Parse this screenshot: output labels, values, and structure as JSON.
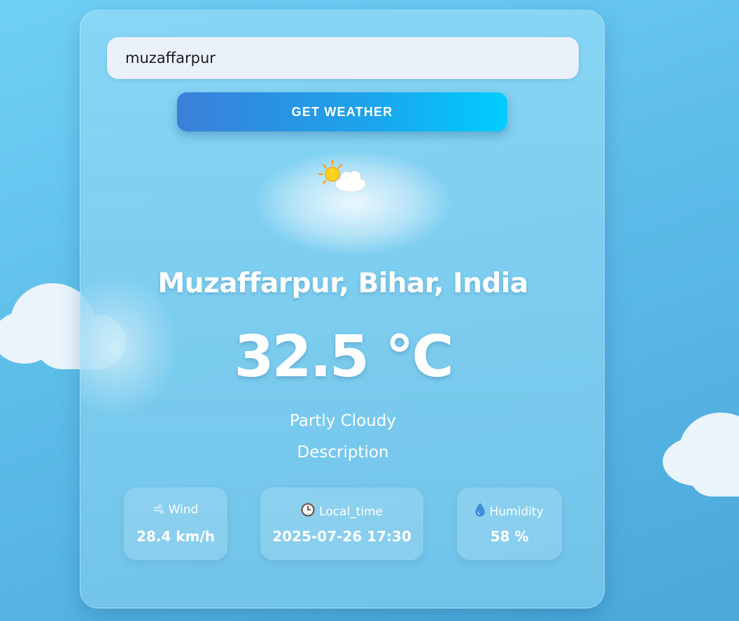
{
  "search": {
    "value": "muzaffarpur",
    "placeholder": ""
  },
  "button": {
    "label": "GET WEATHER"
  },
  "weather": {
    "icon": "sun-behind-cloud-icon",
    "location": "Muzaffarpur, Bihar, India",
    "temperature": "32.5 °C",
    "condition": "Partly Cloudy",
    "description": "Description"
  },
  "stats": {
    "wind": {
      "icon": "wind-icon",
      "label": "Wind",
      "value": "28.4 km/h"
    },
    "local_time": {
      "icon": "clock-icon",
      "label": "Local_time",
      "value": "2025-07-26 17:30"
    },
    "humidity": {
      "icon": "droplet-icon",
      "label": "Humidity",
      "value": "58 %"
    }
  },
  "colors": {
    "background": "#5dbde9",
    "button_start": "#3a7fd8",
    "button_end": "#00cdfe",
    "text": "#ffffff"
  }
}
